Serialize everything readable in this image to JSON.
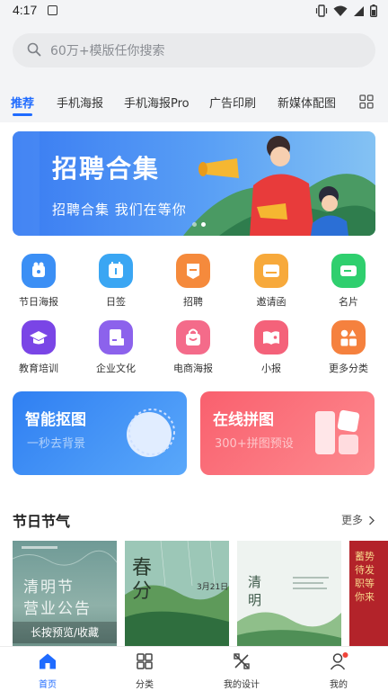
{
  "status_bar": {
    "time": "4:17"
  },
  "search": {
    "placeholder": "60万+模版任你搜索"
  },
  "tabs": [
    {
      "label": "推荐"
    },
    {
      "label": "手机海报"
    },
    {
      "label": "手机海报Pro"
    },
    {
      "label": "广告印刷"
    },
    {
      "label": "新媒体配图"
    }
  ],
  "banner": {
    "title": "招聘合集",
    "subtitle": "招聘合集  我们在等你"
  },
  "categories": [
    {
      "label": "节日海报",
      "color": "#3b8ff5"
    },
    {
      "label": "日签",
      "color": "#3aa6f3"
    },
    {
      "label": "招聘",
      "color": "#f58a3c"
    },
    {
      "label": "邀请函",
      "color": "#f7a93b"
    },
    {
      "label": "名片",
      "color": "#2fcf6e"
    },
    {
      "label": "教育培训",
      "color": "#7a45e6"
    },
    {
      "label": "企业文化",
      "color": "#8c62ec"
    },
    {
      "label": "电商海报",
      "color": "#f46b8a"
    },
    {
      "label": "小报",
      "color": "#f4627a"
    },
    {
      "label": "更多分类",
      "color": "#f5813e"
    }
  ],
  "features": [
    {
      "title": "智能抠图",
      "subtitle": "一秒去背景"
    },
    {
      "title": "在线拼图",
      "subtitle": "300+拼图预设"
    }
  ],
  "section": {
    "title": "节日节气",
    "more": "更多",
    "thumbs": [
      {
        "text": "清明节\n营业公告",
        "overlay": "长按预览/收藏"
      },
      {
        "text": "春分",
        "date": "3月21日"
      },
      {
        "text": "清明"
      },
      {
        "text": "蓄势待发 职等你来"
      }
    ]
  },
  "bottom_nav": [
    {
      "label": "首页"
    },
    {
      "label": "分类"
    },
    {
      "label": "我的设计"
    },
    {
      "label": "我的"
    }
  ]
}
